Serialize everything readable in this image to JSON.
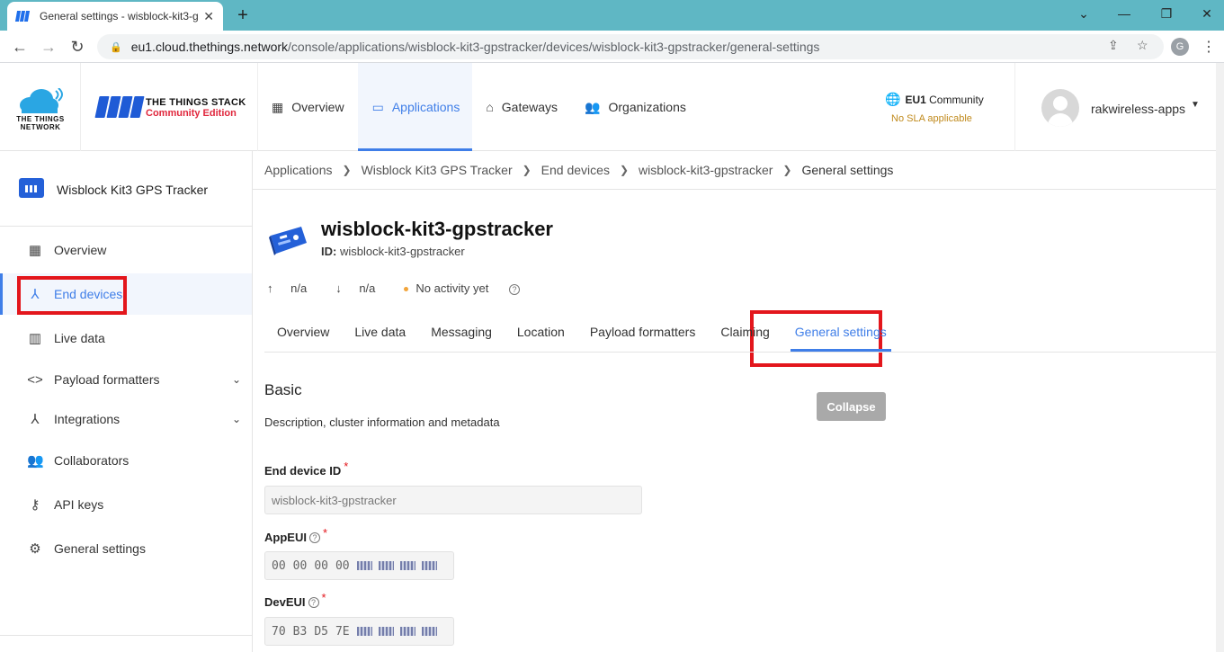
{
  "browser": {
    "tab_title": "General settings - wisblock-kit3-g",
    "url_host": "eu1.cloud.thethings.network",
    "url_path": "/console/applications/wisblock-kit3-gpstracker/devices/wisblock-kit3-gpstracker/general-settings",
    "profile_initial": "G"
  },
  "header": {
    "ttn_logo_text": "THE THINGS NETWORK",
    "tts_title": "THE THINGS STACK",
    "tts_subtitle": "Community Edition",
    "nav": [
      {
        "label": "Overview",
        "icon": "grid-icon"
      },
      {
        "label": "Applications",
        "icon": "window-icon",
        "active": true
      },
      {
        "label": "Gateways",
        "icon": "router-icon"
      },
      {
        "label": "Organizations",
        "icon": "people-icon"
      }
    ],
    "cluster_name": "EU1",
    "cluster_suffix": "Community",
    "sla": "No SLA applicable",
    "username": "rakwireless-apps"
  },
  "sidebar": {
    "app_name": "Wisblock Kit3 GPS Tracker",
    "items": [
      {
        "label": "Overview",
        "icon": "dashboard-icon"
      },
      {
        "label": "End devices",
        "icon": "device-hub-icon",
        "active": true
      },
      {
        "label": "Live data",
        "icon": "bar-chart-icon"
      },
      {
        "label": "Payload formatters",
        "icon": "code-icon",
        "expandable": true
      },
      {
        "label": "Integrations",
        "icon": "merge-icon",
        "expandable": true
      },
      {
        "label": "Collaborators",
        "icon": "group-icon"
      },
      {
        "label": "API keys",
        "icon": "key-icon"
      },
      {
        "label": "General settings",
        "icon": "gear-icon"
      }
    ]
  },
  "breadcrumb": [
    "Applications",
    "Wisblock Kit3 GPS Tracker",
    "End devices",
    "wisblock-kit3-gpstracker",
    "General settings"
  ],
  "device": {
    "title": "wisblock-kit3-gpstracker",
    "id_label": "ID:",
    "id_value": "wisblock-kit3-gpstracker",
    "uplink": "n/a",
    "downlink": "n/a",
    "activity": "No activity yet"
  },
  "tabs": [
    "Overview",
    "Live data",
    "Messaging",
    "Location",
    "Payload formatters",
    "Claiming",
    "General settings"
  ],
  "active_tab": "General settings",
  "basic": {
    "title": "Basic",
    "description": "Description, cluster information and metadata",
    "collapse_label": "Collapse",
    "end_device_id_label": "End device ID",
    "end_device_id_value": "wisblock-kit3-gpstracker",
    "appeui_label": "AppEUI",
    "appeui_visible": [
      "00",
      "00",
      "00",
      "00"
    ],
    "deveui_label": "DevEUI",
    "deveui_visible": [
      "70",
      "B3",
      "D5",
      "7E"
    ]
  },
  "colors": {
    "accent": "#3f7ee8",
    "highlight": "#e3161c",
    "brand_red": "#e0263c",
    "chrome": "#5fb7c4"
  }
}
